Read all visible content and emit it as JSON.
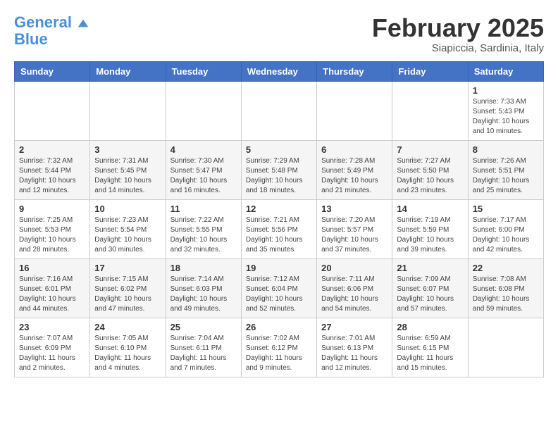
{
  "header": {
    "logo_line1": "General",
    "logo_line2": "Blue",
    "month_title": "February 2025",
    "subtitle": "Siapiccia, Sardinia, Italy"
  },
  "weekdays": [
    "Sunday",
    "Monday",
    "Tuesday",
    "Wednesday",
    "Thursday",
    "Friday",
    "Saturday"
  ],
  "weeks": [
    [
      {
        "day": "",
        "info": ""
      },
      {
        "day": "",
        "info": ""
      },
      {
        "day": "",
        "info": ""
      },
      {
        "day": "",
        "info": ""
      },
      {
        "day": "",
        "info": ""
      },
      {
        "day": "",
        "info": ""
      },
      {
        "day": "1",
        "info": "Sunrise: 7:33 AM\nSunset: 5:43 PM\nDaylight: 10 hours\nand 10 minutes."
      }
    ],
    [
      {
        "day": "2",
        "info": "Sunrise: 7:32 AM\nSunset: 5:44 PM\nDaylight: 10 hours\nand 12 minutes."
      },
      {
        "day": "3",
        "info": "Sunrise: 7:31 AM\nSunset: 5:45 PM\nDaylight: 10 hours\nand 14 minutes."
      },
      {
        "day": "4",
        "info": "Sunrise: 7:30 AM\nSunset: 5:47 PM\nDaylight: 10 hours\nand 16 minutes."
      },
      {
        "day": "5",
        "info": "Sunrise: 7:29 AM\nSunset: 5:48 PM\nDaylight: 10 hours\nand 18 minutes."
      },
      {
        "day": "6",
        "info": "Sunrise: 7:28 AM\nSunset: 5:49 PM\nDaylight: 10 hours\nand 21 minutes."
      },
      {
        "day": "7",
        "info": "Sunrise: 7:27 AM\nSunset: 5:50 PM\nDaylight: 10 hours\nand 23 minutes."
      },
      {
        "day": "8",
        "info": "Sunrise: 7:26 AM\nSunset: 5:51 PM\nDaylight: 10 hours\nand 25 minutes."
      }
    ],
    [
      {
        "day": "9",
        "info": "Sunrise: 7:25 AM\nSunset: 5:53 PM\nDaylight: 10 hours\nand 28 minutes."
      },
      {
        "day": "10",
        "info": "Sunrise: 7:23 AM\nSunset: 5:54 PM\nDaylight: 10 hours\nand 30 minutes."
      },
      {
        "day": "11",
        "info": "Sunrise: 7:22 AM\nSunset: 5:55 PM\nDaylight: 10 hours\nand 32 minutes."
      },
      {
        "day": "12",
        "info": "Sunrise: 7:21 AM\nSunset: 5:56 PM\nDaylight: 10 hours\nand 35 minutes."
      },
      {
        "day": "13",
        "info": "Sunrise: 7:20 AM\nSunset: 5:57 PM\nDaylight: 10 hours\nand 37 minutes."
      },
      {
        "day": "14",
        "info": "Sunrise: 7:19 AM\nSunset: 5:59 PM\nDaylight: 10 hours\nand 39 minutes."
      },
      {
        "day": "15",
        "info": "Sunrise: 7:17 AM\nSunset: 6:00 PM\nDaylight: 10 hours\nand 42 minutes."
      }
    ],
    [
      {
        "day": "16",
        "info": "Sunrise: 7:16 AM\nSunset: 6:01 PM\nDaylight: 10 hours\nand 44 minutes."
      },
      {
        "day": "17",
        "info": "Sunrise: 7:15 AM\nSunset: 6:02 PM\nDaylight: 10 hours\nand 47 minutes."
      },
      {
        "day": "18",
        "info": "Sunrise: 7:14 AM\nSunset: 6:03 PM\nDaylight: 10 hours\nand 49 minutes."
      },
      {
        "day": "19",
        "info": "Sunrise: 7:12 AM\nSunset: 6:04 PM\nDaylight: 10 hours\nand 52 minutes."
      },
      {
        "day": "20",
        "info": "Sunrise: 7:11 AM\nSunset: 6:06 PM\nDaylight: 10 hours\nand 54 minutes."
      },
      {
        "day": "21",
        "info": "Sunrise: 7:09 AM\nSunset: 6:07 PM\nDaylight: 10 hours\nand 57 minutes."
      },
      {
        "day": "22",
        "info": "Sunrise: 7:08 AM\nSunset: 6:08 PM\nDaylight: 10 hours\nand 59 minutes."
      }
    ],
    [
      {
        "day": "23",
        "info": "Sunrise: 7:07 AM\nSunset: 6:09 PM\nDaylight: 11 hours\nand 2 minutes."
      },
      {
        "day": "24",
        "info": "Sunrise: 7:05 AM\nSunset: 6:10 PM\nDaylight: 11 hours\nand 4 minutes."
      },
      {
        "day": "25",
        "info": "Sunrise: 7:04 AM\nSunset: 6:11 PM\nDaylight: 11 hours\nand 7 minutes."
      },
      {
        "day": "26",
        "info": "Sunrise: 7:02 AM\nSunset: 6:12 PM\nDaylight: 11 hours\nand 9 minutes."
      },
      {
        "day": "27",
        "info": "Sunrise: 7:01 AM\nSunset: 6:13 PM\nDaylight: 11 hours\nand 12 minutes."
      },
      {
        "day": "28",
        "info": "Sunrise: 6:59 AM\nSunset: 6:15 PM\nDaylight: 11 hours\nand 15 minutes."
      },
      {
        "day": "",
        "info": ""
      }
    ]
  ]
}
